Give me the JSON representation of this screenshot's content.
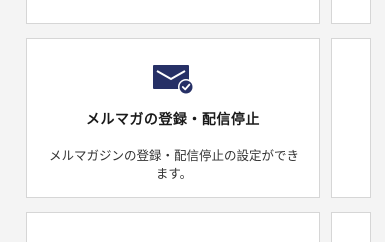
{
  "colors": {
    "icon_primary": "#263066",
    "icon_check_bg": "#263066",
    "card_border": "#d6d6d6",
    "page_bg": "#f4f4f4"
  },
  "main_card": {
    "icon": "envelope-check-icon",
    "title": "メルマガの登録・配信停止",
    "description": "メルマガジンの登録・配信停止の設定ができます。"
  }
}
